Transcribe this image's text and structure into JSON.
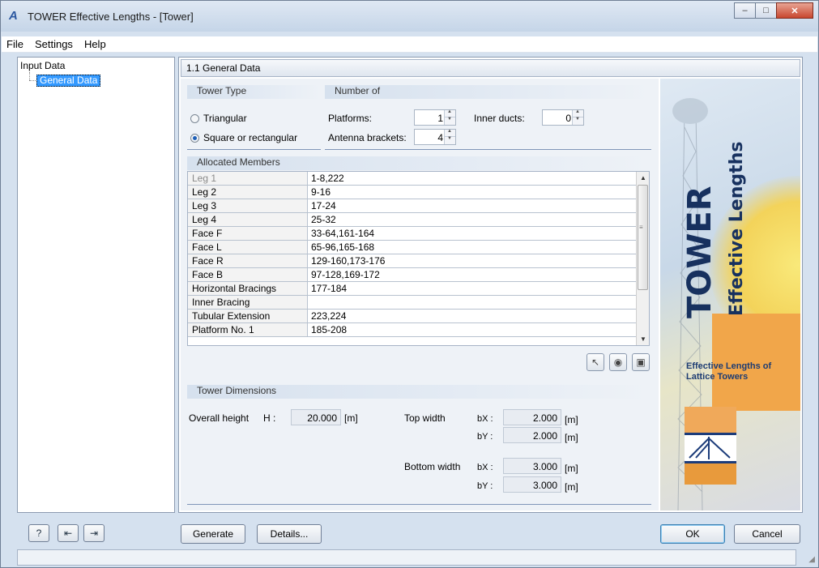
{
  "window": {
    "title": "TOWER Effective Lengths - [Tower]",
    "controls": {
      "minimize": "–",
      "maximize": "□",
      "close": "✕"
    }
  },
  "menu": [
    "File",
    "Settings",
    "Help"
  ],
  "tree": {
    "root": "Input Data",
    "child": "General Data"
  },
  "panel_title": "1.1 General Data",
  "tower_type": {
    "title": "Tower Type",
    "options": [
      "Triangular",
      "Square or rectangular"
    ],
    "selected": "Square or rectangular"
  },
  "number_of": {
    "title": "Number of",
    "platforms_label": "Platforms:",
    "platforms_value": "1",
    "inner_ducts_label": "Inner ducts:",
    "inner_ducts_value": "0",
    "antenna_label": "Antenna brackets:",
    "antenna_value": "4"
  },
  "allocated": {
    "title": "Allocated Members",
    "rows": [
      {
        "name": "Leg 1",
        "members": "1-8,222"
      },
      {
        "name": "Leg 2",
        "members": "9-16"
      },
      {
        "name": "Leg 3",
        "members": "17-24"
      },
      {
        "name": "Leg 4",
        "members": "25-32"
      },
      {
        "name": "Face F",
        "members": "33-64,161-164"
      },
      {
        "name": "Face L",
        "members": "65-96,165-168"
      },
      {
        "name": "Face R",
        "members": "129-160,173-176"
      },
      {
        "name": "Face B",
        "members": "97-128,169-172"
      },
      {
        "name": "Horizontal Bracings",
        "members": "177-184"
      },
      {
        "name": "Inner Bracing",
        "members": ""
      },
      {
        "name": "Tubular Extension",
        "members": "223,224"
      },
      {
        "name": "Platform No. 1",
        "members": "185-208"
      }
    ]
  },
  "dimensions": {
    "title": "Tower Dimensions",
    "height_label": "Overall height",
    "height_symbol": "H :",
    "height_value": "20.000",
    "unit": "[m]",
    "top_width_label": "Top width",
    "bottom_width_label": "Bottom width",
    "bx_label": "bX :",
    "by_label": "bY :",
    "top_bx": "2.000",
    "top_by": "2.000",
    "bottom_bx": "3.000",
    "bottom_by": "3.000"
  },
  "banner": {
    "title": "TOWER",
    "subtitle": "Effective Lengths",
    "caption": "Effective Lengths of Lattice Towers"
  },
  "buttons": {
    "generate": "Generate",
    "details": "Details...",
    "ok": "OK",
    "cancel": "Cancel"
  },
  "colors": {
    "selection": "#3399ff",
    "accent": "#17315f",
    "orange": "#f1a64a"
  }
}
